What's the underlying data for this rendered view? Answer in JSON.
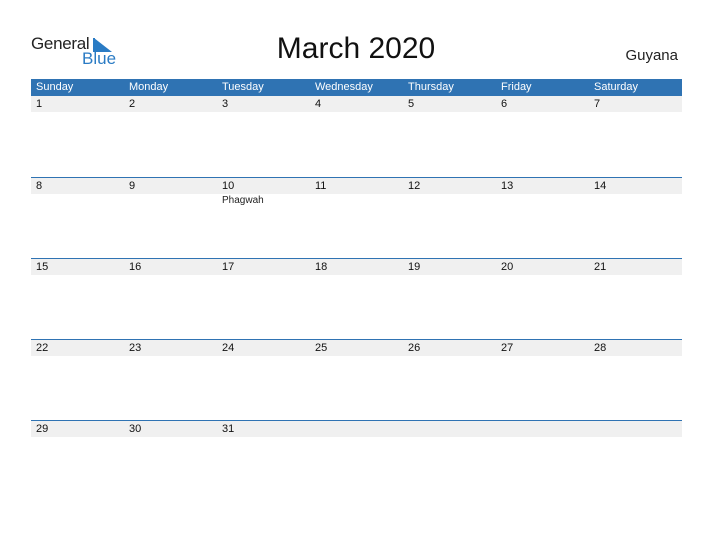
{
  "logo": {
    "word1": "General",
    "word2": "Blue"
  },
  "title": "March 2020",
  "country": "Guyana",
  "weekdays": [
    "Sunday",
    "Monday",
    "Tuesday",
    "Wednesday",
    "Thursday",
    "Friday",
    "Saturday"
  ],
  "weeks": [
    {
      "dates": [
        "1",
        "2",
        "3",
        "4",
        "5",
        "6",
        "7"
      ],
      "events": [
        "",
        "",
        "",
        "",
        "",
        "",
        ""
      ]
    },
    {
      "dates": [
        "8",
        "9",
        "10",
        "11",
        "12",
        "13",
        "14"
      ],
      "events": [
        "",
        "",
        "Phagwah",
        "",
        "",
        "",
        ""
      ]
    },
    {
      "dates": [
        "15",
        "16",
        "17",
        "18",
        "19",
        "20",
        "21"
      ],
      "events": [
        "",
        "",
        "",
        "",
        "",
        "",
        ""
      ]
    },
    {
      "dates": [
        "22",
        "23",
        "24",
        "25",
        "26",
        "27",
        "28"
      ],
      "events": [
        "",
        "",
        "",
        "",
        "",
        "",
        ""
      ]
    },
    {
      "dates": [
        "29",
        "30",
        "31",
        "",
        "",
        "",
        ""
      ],
      "events": [
        "",
        "",
        "",
        "",
        "",
        "",
        ""
      ]
    }
  ],
  "colors": {
    "accent": "#2f73b3",
    "date_bar": "#f0f0f0",
    "logo_blue": "#2a7bc4"
  }
}
